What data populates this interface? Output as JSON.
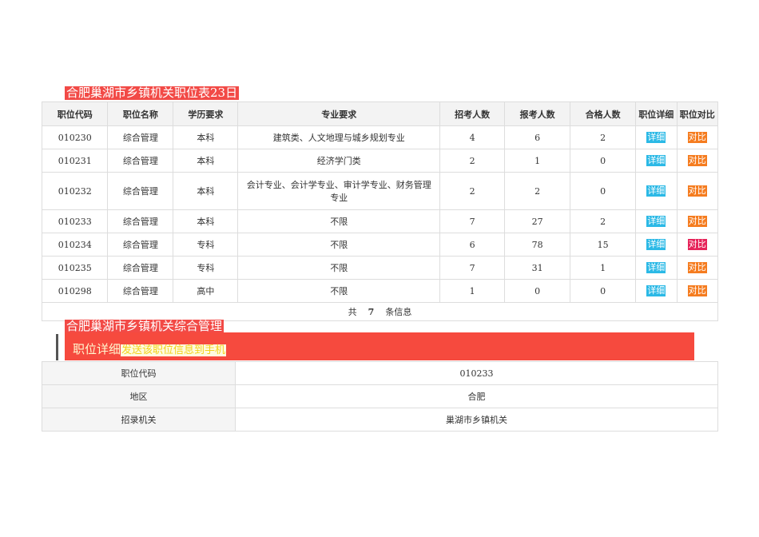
{
  "title": "合肥巢湖市乡镇机关职位表23日",
  "table": {
    "headers": [
      "职位代码",
      "职位名称",
      "学历要求",
      "专业要求",
      "招考人数",
      "报考人数",
      "合格人数",
      "职位详细",
      "职位对比"
    ],
    "rows": [
      {
        "code": "010230",
        "name": "综合管理",
        "edu": "本科",
        "major": "建筑类、人文地理与城乡规划专业",
        "recruit": "4",
        "applied": "6",
        "qualified": "2",
        "detail": "详细",
        "compare": "对比"
      },
      {
        "code": "010231",
        "name": "综合管理",
        "edu": "本科",
        "major": "经济学门类",
        "recruit": "2",
        "applied": "1",
        "qualified": "0",
        "detail": "详细",
        "compare": "对比"
      },
      {
        "code": "010232",
        "name": "综合管理",
        "edu": "本科",
        "major": "会计专业、会计学专业、审计学专业、财务管理专业",
        "recruit": "2",
        "applied": "2",
        "qualified": "0",
        "detail": "详细",
        "compare": "对比"
      },
      {
        "code": "010233",
        "name": "综合管理",
        "edu": "本科",
        "major": "不限",
        "recruit": "7",
        "applied": "27",
        "qualified": "2",
        "detail": "详细",
        "compare": "对比"
      },
      {
        "code": "010234",
        "name": "综合管理",
        "edu": "专科",
        "major": "不限",
        "recruit": "6",
        "applied": "78",
        "qualified": "15",
        "detail": "详细",
        "compare": "对比"
      },
      {
        "code": "010235",
        "name": "综合管理",
        "edu": "专科",
        "major": "不限",
        "recruit": "7",
        "applied": "31",
        "qualified": "1",
        "detail": "详细",
        "compare": "对比"
      },
      {
        "code": "010298",
        "name": "综合管理",
        "edu": "高中",
        "major": "不限",
        "recruit": "1",
        "applied": "0",
        "qualified": "0",
        "detail": "详细",
        "compare": "对比"
      }
    ],
    "footer": {
      "prefix": "共",
      "count": "7",
      "suffix": "条信息"
    }
  },
  "subtitle": "合肥巢湖市乡镇机关综合管理",
  "detail_bar": {
    "label": "职位详细",
    "send": "发送该职位信息到手机"
  },
  "detail": [
    {
      "k": "职位代码",
      "v": "010233"
    },
    {
      "k": "地区",
      "v": "合肥"
    },
    {
      "k": "招录机关",
      "v": "巢湖市乡镇机关"
    }
  ]
}
